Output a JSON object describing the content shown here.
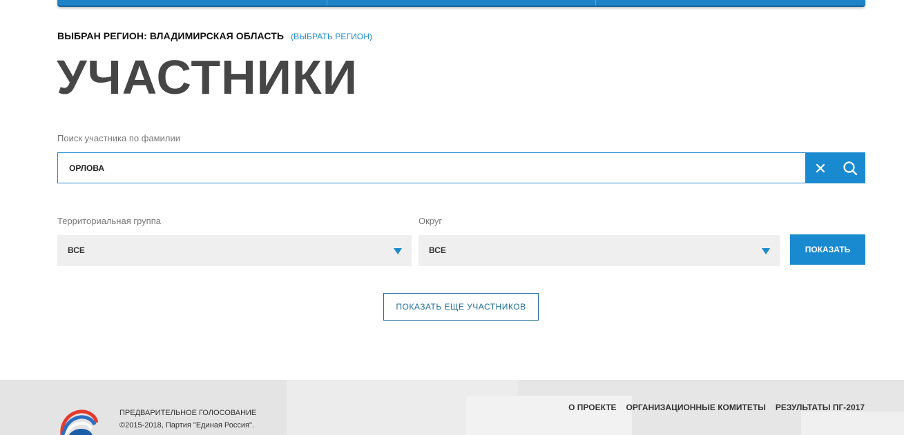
{
  "region": {
    "prefix": "ВЫБРАН РЕГИОН: ВЛАДИМИРСКАЯ ОБЛАСТЬ",
    "change_link": "(ВЫБРАТЬ РЕГИОН)"
  },
  "page": {
    "title": "УЧАСТНИКИ"
  },
  "search": {
    "label": "Поиск участника по фамилии",
    "value": "ОРЛОВА"
  },
  "filters": {
    "group_label": "Территориальная группа",
    "group_value": "ВСЕ",
    "district_label": "Округ",
    "district_value": "ВСЕ",
    "show_button": "ПОКАЗАТЬ"
  },
  "more_button": "ПОКАЗАТЬ ЕЩЕ УЧАСТНИКОВ",
  "footer": {
    "line1": "ПРЕДВАРИТЕЛЬНОЕ ГОЛОСОВАНИЕ",
    "line2": "©2015-2018, Партия \"Единая Россия\".",
    "nav": [
      "О ПРОЕКТЕ",
      "ОРГАНИЗАЦИОННЫЕ КОМИТЕТЫ",
      "РЕЗУЛЬТАТЫ ПГ-2017"
    ]
  },
  "colors": {
    "accent": "#1a8ad0",
    "title": "#464646",
    "select_bg": "#efefef",
    "footer_bg": "#e9e9e9"
  },
  "icons": {
    "clear": "close-icon",
    "search": "search-icon",
    "dropdown": "triangle-down-icon",
    "logo": "party-bear-logo"
  }
}
